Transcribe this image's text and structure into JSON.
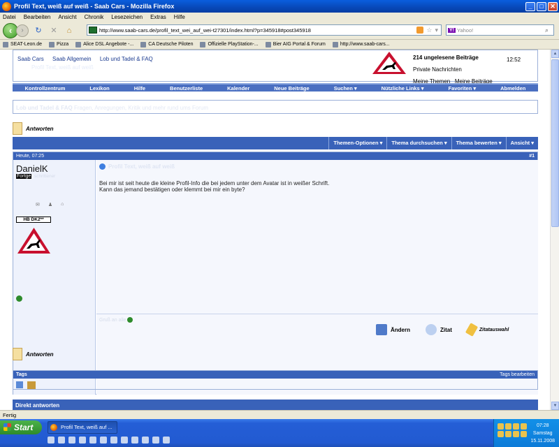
{
  "window": {
    "title": "Profil Text, weiß auf weiß - Saab Cars - Mozilla Firefox"
  },
  "menu": [
    "Datei",
    "Bearbeiten",
    "Ansicht",
    "Chronik",
    "Lesezeichen",
    "Extras",
    "Hilfe"
  ],
  "urlbar": {
    "url": "http://www.saab-cars.de/profil_text_wei_auf_wei-t27301/index.html?p=345918#post345918"
  },
  "search": {
    "engine": "Y!",
    "placeholder": "Yahoo!"
  },
  "bookmarks": [
    "SEAT-Leon.de",
    "Pizza",
    "Alice DSL Angebote -...",
    "CA Deutsche Piloten",
    "Offizielle PlayStation-...",
    "Bier AIG Portal & Forum",
    "http://www.saab-cars..."
  ],
  "forum": {
    "breadcrumb": [
      "Saab Cars",
      "Saab Allgemein",
      "Lob und Tadel & FAQ"
    ],
    "thread_title": "Profil Text, weiß auf weiß",
    "notifications": {
      "unread": "214 ungelesene Beiträge",
      "private": "Private Nachrichten",
      "my_threads": "Meine Themen",
      "my_posts": "Meine Beiträge",
      "time": "12:52"
    },
    "navtabs": [
      "Kontrollzentrum",
      "Lexikon",
      "Hilfe",
      "Benutzerliste",
      "Kalender",
      "Neue Beiträge",
      "Suchen ▾",
      "Nützliche Links ▾",
      "Favoriten ▾",
      "Abmelden"
    ],
    "forum_desc_title": "Lob und Tadel & FAQ",
    "forum_desc_text": "Fragen, Anregungen, Kritik und mehr rund ums Forum",
    "reply_label": "Antworten",
    "thread_tools": [
      "Themen-Optionen ▾",
      "Thema durchsuchen ▾",
      "Thema bewerten ▾",
      "Ansicht ▾"
    ],
    "post": {
      "date": "Heute, 07:25",
      "number": "#1",
      "username": "DanielK",
      "user_title": "Fortge",
      "user_title_faded": "schrittener",
      "plate": "HB DK2**",
      "title": "Profil Text, weiß auf weiß",
      "text_line1": "Bei mir ist seit heute die kleine Profil-Info die bei jedem unter dem Avatar ist in weißer Schrift.",
      "text_line2": "Kann das jemand bestätigen oder klemmt bei mir ein byte?",
      "signature": "Gruß an alle",
      "actions": {
        "edit": "Ändern",
        "quote": "Zitat",
        "multiquote": "Zitatauswahl"
      }
    },
    "tags": {
      "label": "Tags",
      "edit": "Tags bearbeiten"
    },
    "direct_reply": "Direkt antworten"
  },
  "status": "Fertig",
  "taskbar": {
    "start": "Start",
    "item": "Profil Text, weiß auf ...",
    "time": "07:28",
    "day": "Samstag",
    "date": "15.11.2008"
  }
}
